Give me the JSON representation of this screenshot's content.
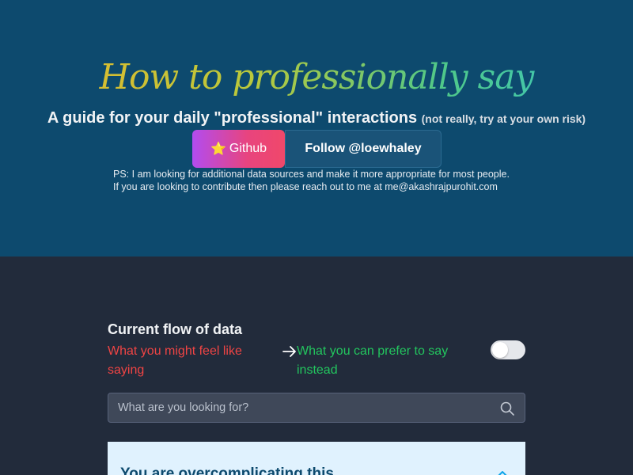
{
  "hero": {
    "title": "How to professionally say",
    "subtitle": "A guide for your daily \"professional\" interactions",
    "subtitle_small": "(not really, try at your own risk)",
    "bg_color": "#0d4a6e",
    "github_label": "Github",
    "github_icon": "star-icon",
    "follow_label": "Follow @loewhaley",
    "note_line1": "PS: I am looking for additional data sources and make it more appropriate for most people.",
    "note_line2": "If you are looking to contribute then please reach out to me at me@akashrajpurohit.com"
  },
  "flow": {
    "title": "Current flow of data",
    "left": "What you might feel like saying",
    "right": "What you can prefer to say instead",
    "arrow_icon": "arrow-right-icon",
    "toggle_on": false
  },
  "search": {
    "placeholder": "What are you looking for?",
    "value": "",
    "icon": "search-icon"
  },
  "card": {
    "title": "You are overcomplicating this",
    "icon": "chevron-up-icon",
    "bg_color": "#e0f2fe"
  }
}
